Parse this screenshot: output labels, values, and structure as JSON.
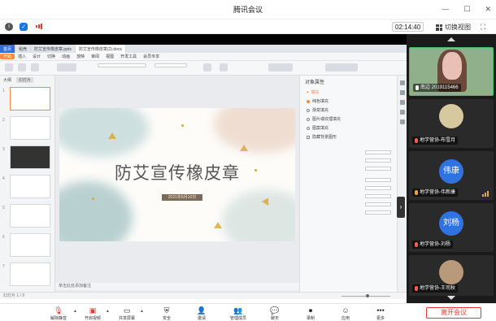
{
  "window": {
    "title": "腾讯会议"
  },
  "infobar": {
    "timer": "02:14:40",
    "switch_view_label": "切换视图"
  },
  "shared_screen": {
    "tabs": [
      "首页",
      "稻壳",
      "防艾宣传橡皮章.pptx",
      "防艾宣传橡皮章(2).docx"
    ],
    "ribbon_tabs": [
      "开始",
      "插入",
      "设计",
      "切换",
      "动画",
      "放映",
      "审阅",
      "视图",
      "开发工具",
      "会员专享"
    ],
    "ribbon_selected": "开始",
    "left_pane_tabs": [
      "大纲",
      "幻灯片"
    ],
    "slide": {
      "title": "防艾宣传橡皮章",
      "date_tag": "2021年6月10日"
    },
    "notes_placeholder": "单击此处添加备注",
    "right_pane": {
      "title": "对象属性",
      "section": "填充",
      "options": [
        "纯色填充",
        "渐变填充",
        "图片或纹理填充",
        "图案填充",
        "隐藏背景图形"
      ]
    },
    "status_left": "幻灯片 1 / 9"
  },
  "participants": [
    {
      "name": "南边 2019115466",
      "type": "video"
    },
    {
      "name": "地学营协-布雪月",
      "type": "photo"
    },
    {
      "name": "地学营协-伟新康",
      "avatar_text": "伟康",
      "type": "avatar"
    },
    {
      "name": "地学营协-刘杨",
      "avatar_text": "刘杨",
      "type": "avatar"
    },
    {
      "name": "地学营协-王司秋",
      "type": "photo"
    }
  ],
  "toolbar": {
    "items": [
      "解除静音",
      "开启视频",
      "共享屏幕",
      "安全",
      "邀请",
      "管理成员",
      "聊天",
      "录制",
      "应用",
      "更多"
    ],
    "leave_label": "离开会议"
  },
  "colors": {
    "accent_orange": "#ff8a3d",
    "leave_red": "#e53935",
    "avatar_blue": "#2f73e0"
  }
}
